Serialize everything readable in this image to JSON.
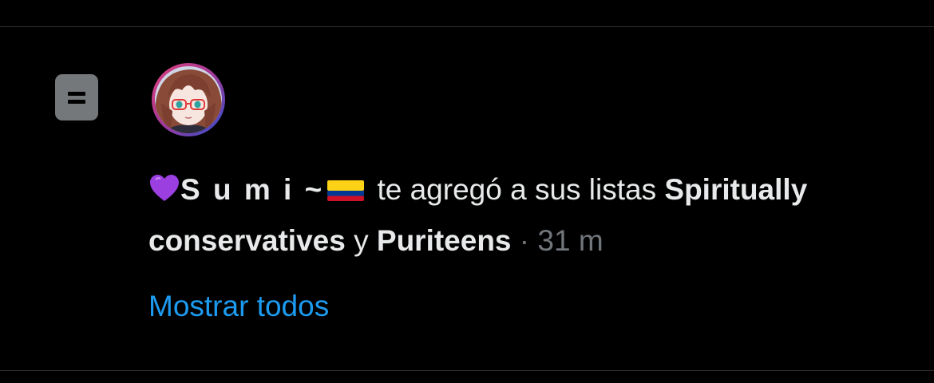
{
  "notification": {
    "user_display_name": "S u m i ~",
    "action_text": " te agregó a sus listas ",
    "list_1": "Spiritually conservatives",
    "conjunction": " y ",
    "list_2": "Puriteens",
    "separator": " · ",
    "time": "31 m"
  },
  "show_all_label": "Mostrar todos",
  "icons": {
    "notification_type": "list-icon",
    "name_prefix": "purple-heart-icon",
    "name_suffix": "colombia-flag-icon"
  },
  "colors": {
    "background": "#000000",
    "text": "#e7e9ea",
    "muted": "#71767b",
    "link": "#1d9bf0",
    "divider": "#2f3336",
    "icon": "#75787b"
  }
}
